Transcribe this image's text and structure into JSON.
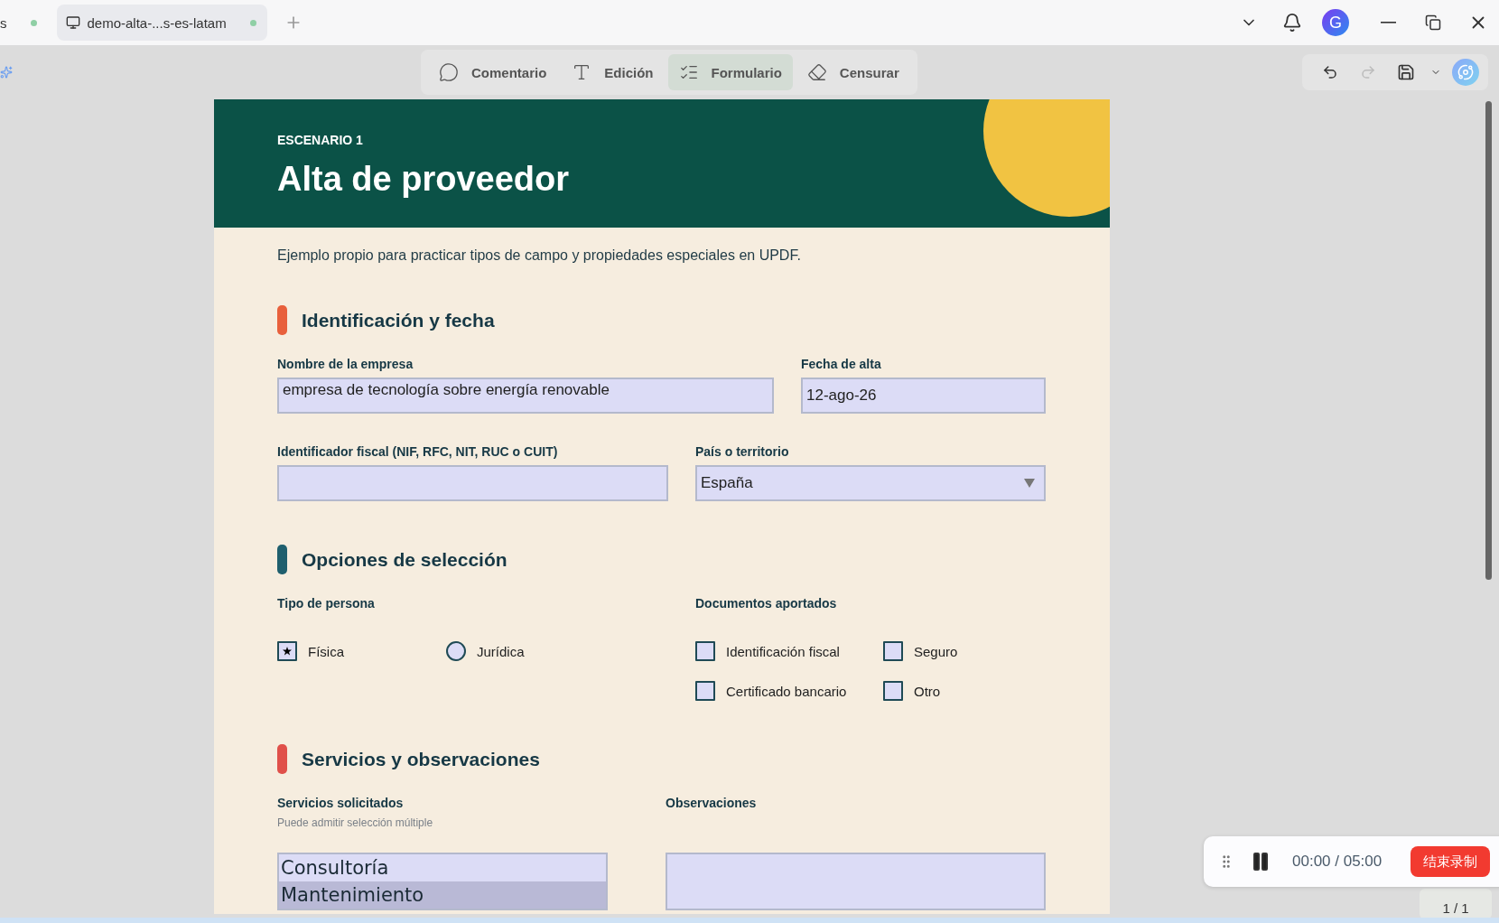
{
  "tabs": [
    {
      "label": "s",
      "selected": false
    },
    {
      "label": "demo-alta-...s-es-latam",
      "selected": true
    }
  ],
  "avatar_initial": "G",
  "modes": [
    {
      "label": "Comentario",
      "selected": false
    },
    {
      "label": "Edición",
      "selected": false
    },
    {
      "label": "Formulario",
      "selected": true
    },
    {
      "label": "Censurar",
      "selected": false
    }
  ],
  "document": {
    "eyebrow": "ESCENARIO 1",
    "title": "Alta de proveedor",
    "description": "Ejemplo propio para practicar tipos de campo y propiedades especiales en UPDF.",
    "sections": [
      {
        "title": "Identificación y fecha",
        "color": "#e8603c",
        "groups": [
          {
            "kind": "text",
            "label": "Nombre de la empresa",
            "value": "empresa de tecnología sobre energía renovable"
          },
          {
            "kind": "text",
            "label": "Fecha de alta",
            "value": "12-ago-26"
          },
          {
            "kind": "text",
            "label": "Identificador fiscal (NIF, RFC, NIT, RUC o CUIT)"
          },
          {
            "kind": "dropdown",
            "label": "País o territorio",
            "value": "España"
          }
        ]
      },
      {
        "title": "Opciones de selección",
        "color": "#1f5f6e",
        "groups": [
          {
            "kind": "radio",
            "label": "Tipo de persona",
            "options": [
              {
                "label": "Física",
                "selected": true
              },
              {
                "label": "Jurídica",
                "selected": false
              }
            ]
          },
          {
            "kind": "checkbox",
            "label": "Documentos aportados",
            "options": [
              {
                "label": "Identificación fiscal",
                "checked": false
              },
              {
                "label": "Seguro",
                "checked": false
              },
              {
                "label": "Certificado bancario",
                "checked": false
              },
              {
                "label": "Otro",
                "checked": false
              }
            ]
          }
        ]
      },
      {
        "title": "Servicios y observaciones",
        "color": "#e0504a",
        "groups": [
          {
            "kind": "listbox",
            "label": "Servicios solicitados",
            "hint": "Puede admitir selección múltiple",
            "options": [
              {
                "label": "Consultoría",
                "selected": false
              },
              {
                "label": "Mantenimiento",
                "selected": true
              }
            ]
          },
          {
            "kind": "textarea",
            "label": "Observaciones"
          }
        ]
      }
    ]
  },
  "recorder": {
    "time": "00:00 / 05:00",
    "stop_label": "结束录制"
  },
  "page_indicator": "1 / 1"
}
